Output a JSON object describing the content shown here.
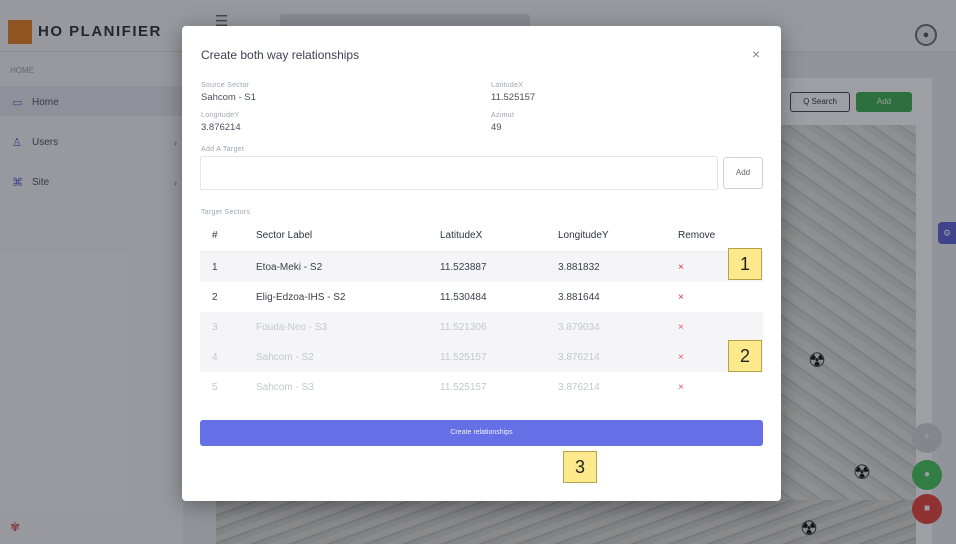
{
  "app": {
    "brand": "HO PLANIFIER",
    "section": "HOME"
  },
  "sidebar": {
    "items": [
      {
        "label": "Home",
        "icon": "monitor-icon"
      },
      {
        "label": "Users",
        "icon": "user-icon"
      },
      {
        "label": "Site",
        "icon": "command-icon"
      }
    ]
  },
  "main": {
    "search_label": "Q Search",
    "add_label": "Add"
  },
  "modal": {
    "title": "Create both way relationships",
    "close": "×",
    "source": {
      "sector_label": "Source Sector",
      "sector_value": "Sahcom - S1",
      "lat_label": "LatitudeX",
      "lat_value": "11.525157",
      "lon_label": "LongitudeY",
      "lon_value": "3.876214",
      "azimut_label": "Azimut",
      "azimut_value": "49"
    },
    "target": {
      "label": "Add A Target",
      "placeholder": "",
      "add_button": "Add"
    },
    "table": {
      "caption": "Target Sectors",
      "headers": [
        "#",
        "Sector Label",
        "LatitudeX",
        "LongitudeY",
        "Remove"
      ],
      "rows": [
        {
          "num": "1",
          "label": "Etoa-Meki - S2",
          "lat": "11.523887",
          "lon": "3.881832",
          "remove": "×"
        },
        {
          "num": "2",
          "label": "Elig-Edzoa-IHS - S2",
          "lat": "11.530484",
          "lon": "3.881644",
          "remove": "×"
        },
        {
          "num": "3",
          "label": "Fouda-Neo - S3",
          "lat": "11.521306",
          "lon": "3.879034",
          "remove": "×"
        },
        {
          "num": "4",
          "label": "Sahcom - S2",
          "lat": "11.525157",
          "lon": "3.876214",
          "remove": "×"
        },
        {
          "num": "5",
          "label": "Sahcom - S3",
          "lat": "11.525157",
          "lon": "3.876214",
          "remove": "×"
        }
      ]
    },
    "create_button": "Create relationships"
  },
  "annotations": [
    "1",
    "2",
    "3"
  ],
  "colors": {
    "accent": "#6670e6",
    "remove": "#e0303a",
    "badge": "#fbe98b",
    "add_green": "#3fae4e"
  }
}
